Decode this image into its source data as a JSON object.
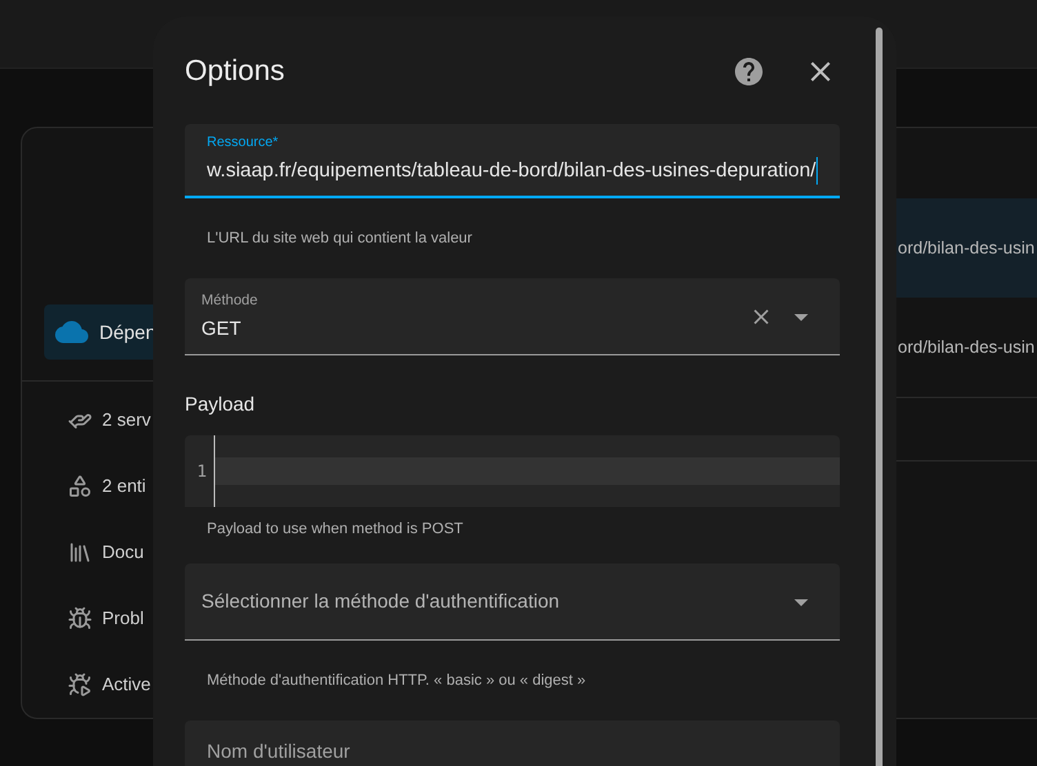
{
  "background": {
    "integration": {
      "label": "Dépen",
      "selected": true
    },
    "links": [
      {
        "label": "2 serv"
      },
      {
        "label": "2 enti"
      },
      {
        "label": "Docu"
      },
      {
        "label": "Probl"
      },
      {
        "label": "Active"
      }
    ],
    "rows": [
      {
        "text": "ord/bilan-des-usin",
        "selected": true
      },
      {
        "text": "ord/bilan-des-usin",
        "selected": false
      }
    ]
  },
  "dialog": {
    "title": "Options",
    "fields": [
      {
        "kind": "text",
        "label": "Ressource*",
        "value": "w.siaap.fr/equipements/tableau-de-bord/bilan-des-usines-depuration/",
        "focused": true,
        "helper": "L'URL du site web qui contient la valeur"
      },
      {
        "kind": "select",
        "label": "Méthode",
        "value": "GET"
      },
      {
        "kind": "code",
        "heading": "Payload",
        "line_number": "1",
        "helper": "Payload to use when method is POST"
      },
      {
        "kind": "select",
        "placeholder": "Sélectionner la méthode d'authentification",
        "helper": "Méthode d'authentification HTTP. « basic » ou « digest »"
      },
      {
        "kind": "text",
        "placeholder": "Nom d'utilisateur"
      }
    ]
  }
}
